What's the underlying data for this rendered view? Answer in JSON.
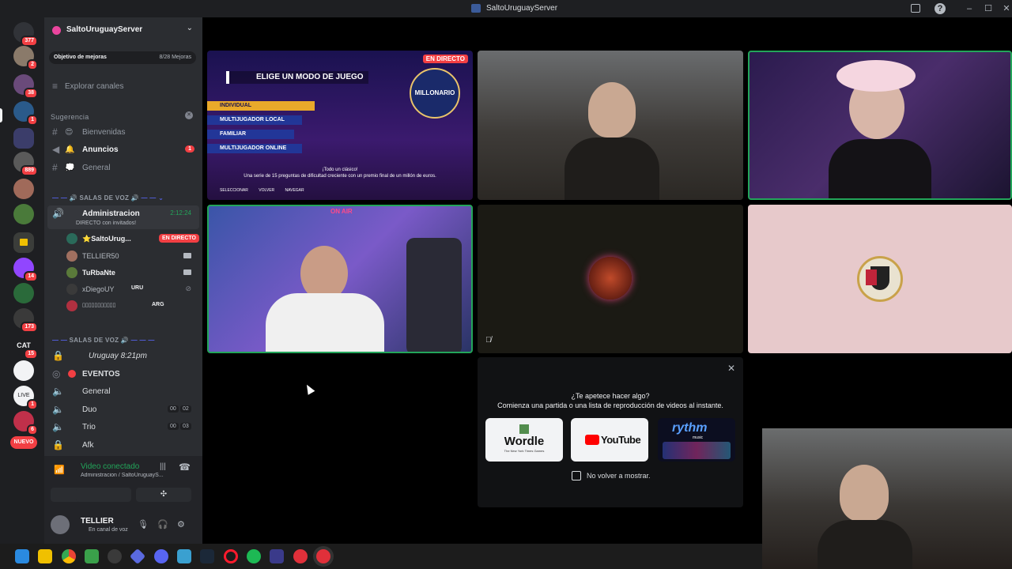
{
  "window": {
    "title": "SaltoUruguayServer"
  },
  "rail": {
    "badges": [
      "377",
      "2",
      "38",
      "1",
      "889",
      "14",
      "173",
      "15",
      "1",
      "6"
    ],
    "cat_label": "CAT",
    "new_label": "NUEVO",
    "live_label": "LIVE"
  },
  "server": {
    "name": "SaltoUruguayServer",
    "goal_label": "Objetivo de mejoras",
    "goal_progress": "8/28 Mejoras",
    "explore": "Explorar canales",
    "suggestion": "Sugerencia",
    "channels": [
      {
        "name": "Bienvenidas",
        "emoji": "😍"
      },
      {
        "name": "Anuncios",
        "emoji": "🔔",
        "count": "1"
      },
      {
        "name": "General",
        "emoji": "💭"
      }
    ],
    "voice_cat_1": "SALAS DE VOZ",
    "admin_channel": "Administracion",
    "admin_timer": "2:12:24",
    "admin_sub": "DIRECTO con invitados!",
    "voice_users": [
      {
        "name": "⭐SaltoUrug...",
        "tag": "EN DIRECTO"
      },
      {
        "name": "TELLIER50"
      },
      {
        "name": "TuRbaNte"
      },
      {
        "name": "xDiegoUY",
        "suffix": "URU"
      },
      {
        "name": "▯▯▯▯▯▯▯▯▯▯▯",
        "suffix": "ARG"
      }
    ],
    "voice_cat_2": "SALAS DE VOZ",
    "voice_channels": [
      {
        "name": "Uruguay  8:21pm"
      },
      {
        "name": "EVENTOS"
      },
      {
        "name": "General"
      },
      {
        "name": "Duo",
        "a": "00",
        "b": "02"
      },
      {
        "name": "Trio",
        "a": "00",
        "b": "03"
      },
      {
        "name": "Afk"
      }
    ]
  },
  "voice_panel": {
    "status": "Video conectado",
    "location": "Administracion / SaltoUruguayS..."
  },
  "user_panel": {
    "name": "TELLIER",
    "status": "En canal de voz"
  },
  "stream": {
    "live_tag": "EN DIRECTO",
    "game_heading": "ELIGE UN MODO DE JUEGO",
    "game_logo": "MILLONARIO",
    "game_options": [
      "INDIVIDUAL",
      "MULTIJUGADOR LOCAL",
      "FAMILIAR",
      "MULTIJUGADOR ONLINE"
    ],
    "game_caption_1": "¡Todo un clásico!",
    "game_caption_2": "Una serie de 15 preguntas de dificultad creciente con un premio final de un millón de euros.",
    "game_controls": [
      "SELECCIONAR",
      "VOLVER",
      "NAVEGAR"
    ],
    "on_air": "ON AIR"
  },
  "activity": {
    "question": "¿Te apetece hacer algo?",
    "subtitle": "Comienza una partida o una lista de reproducción de videos al instante.",
    "apps": [
      "Wordle",
      "YouTube",
      "rythm"
    ],
    "wordle_sub": "The New York Times Games",
    "rythm_sub": "music",
    "dont_show": "No volver a mostrar."
  },
  "colors": {
    "accent": "#5865f2",
    "online": "#23a55a",
    "danger": "#f23f43",
    "sidebar": "#2b2d31",
    "rail": "#1e1f22"
  }
}
